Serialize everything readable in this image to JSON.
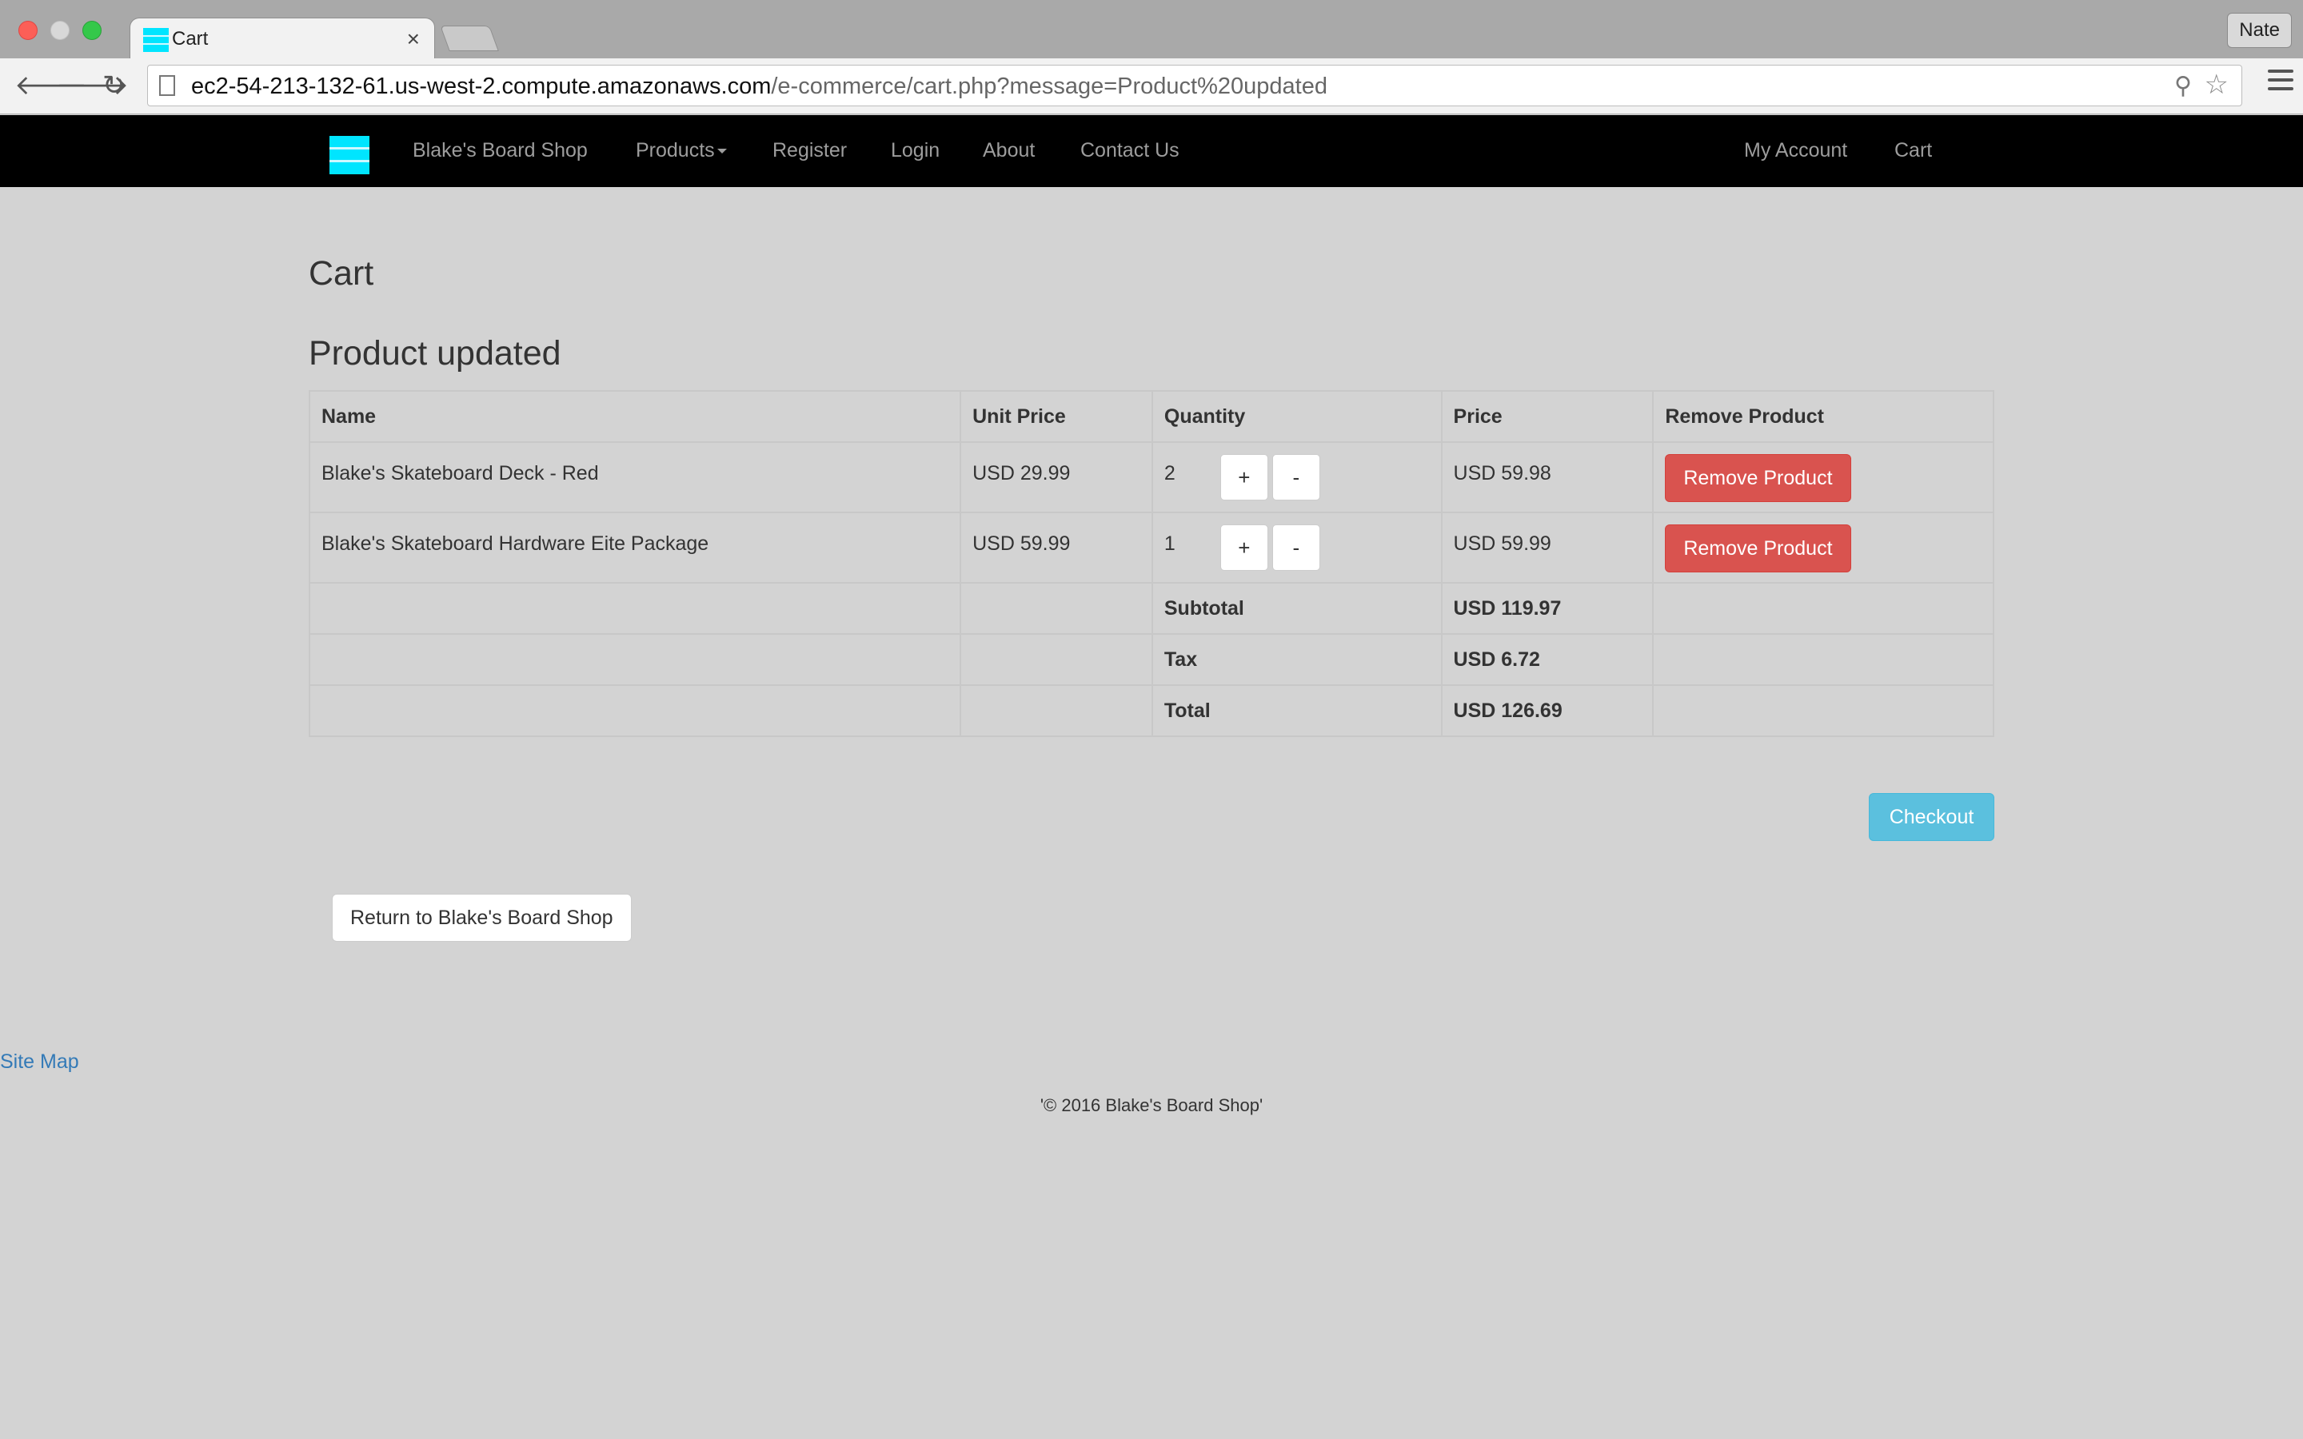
{
  "browser": {
    "tab_title": "Cart",
    "tab_close": "×",
    "user_name": "Nate",
    "url_host": "ec2-54-213-132-61.us-west-2.compute.amazonaws.com",
    "url_path": "/e-commerce/cart.php?message=Product%20updated",
    "back_icon": "🡐",
    "forward_icon": "🡒",
    "reload_icon": "↻",
    "search_icon": "⚲",
    "star_icon": "☆"
  },
  "navbar": {
    "brand": "Blake's Board Shop",
    "links": [
      "Products",
      "Register",
      "Login",
      "About",
      "Contact Us"
    ],
    "right_links": [
      "My Account",
      "Cart"
    ],
    "logo_color": "#00e5ff"
  },
  "page": {
    "title": "Cart",
    "message": "Product updated"
  },
  "cart": {
    "headers": [
      "Name",
      "Unit Price",
      "Quantity",
      "Price",
      "Remove Product"
    ],
    "rows": [
      {
        "name": "Blake's Skateboard Deck - Red",
        "unit_price": "USD 29.99",
        "quantity": "2",
        "price": "USD 59.98",
        "remove_label": "Remove Product"
      },
      {
        "name": "Blake's Skateboard Hardware Eite Package",
        "unit_price": "USD 59.99",
        "quantity": "1",
        "price": "USD 59.99",
        "remove_label": "Remove Product"
      }
    ],
    "increment_label": "+",
    "decrement_label": "-",
    "subtotal_label": "Subtotal",
    "subtotal": "USD 119.97",
    "tax_label": "Tax",
    "tax": "USD 6.72",
    "total_label": "Total",
    "total": "USD 126.69"
  },
  "actions": {
    "checkout_label": "Checkout",
    "return_label": "Return to Blake's Board Shop"
  },
  "footer": {
    "site_map": "Site Map",
    "copyright": "'© 2016 Blake's Board Shop'"
  },
  "colors": {
    "danger": "#d9534f",
    "info": "#5bc0de",
    "link": "#337ab7",
    "navbar": "#000000",
    "page_bg": "#d3d3d3"
  }
}
